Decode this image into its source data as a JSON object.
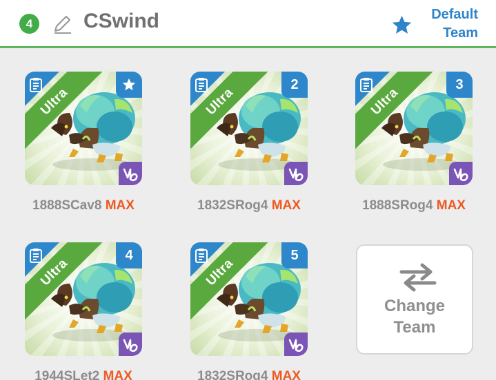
{
  "header": {
    "team_number": "4",
    "team_name": "CSwind",
    "default_team_label": "Default Team",
    "accent_color": "#5db55e",
    "link_color": "#2f84c8",
    "icons": [
      "pencil-icon",
      "star-icon"
    ]
  },
  "cards": [
    {
      "slot": "star",
      "rank": "Ultra",
      "label": "1888SCav8",
      "max": "MAX"
    },
    {
      "slot": "2",
      "rank": "Ultra",
      "label": "1832SRog4",
      "max": "MAX"
    },
    {
      "slot": "3",
      "rank": "Ultra",
      "label": "1888SRog4",
      "max": "MAX"
    },
    {
      "slot": "4",
      "rank": "Ultra",
      "label": "1944SLet2",
      "max": "MAX"
    },
    {
      "slot": "5",
      "rank": "Ultra",
      "label": "1832SRog4",
      "max": "MAX"
    }
  ],
  "change_team": {
    "line1": "Change",
    "line2": "Team",
    "icon": "swap-arrows-icon"
  },
  "colors": {
    "rank_ribbon": "#5aa93f",
    "slot_badge": "#2e86cb",
    "capricorn_badge": "#7a55b6",
    "max": "#ec5a24"
  }
}
